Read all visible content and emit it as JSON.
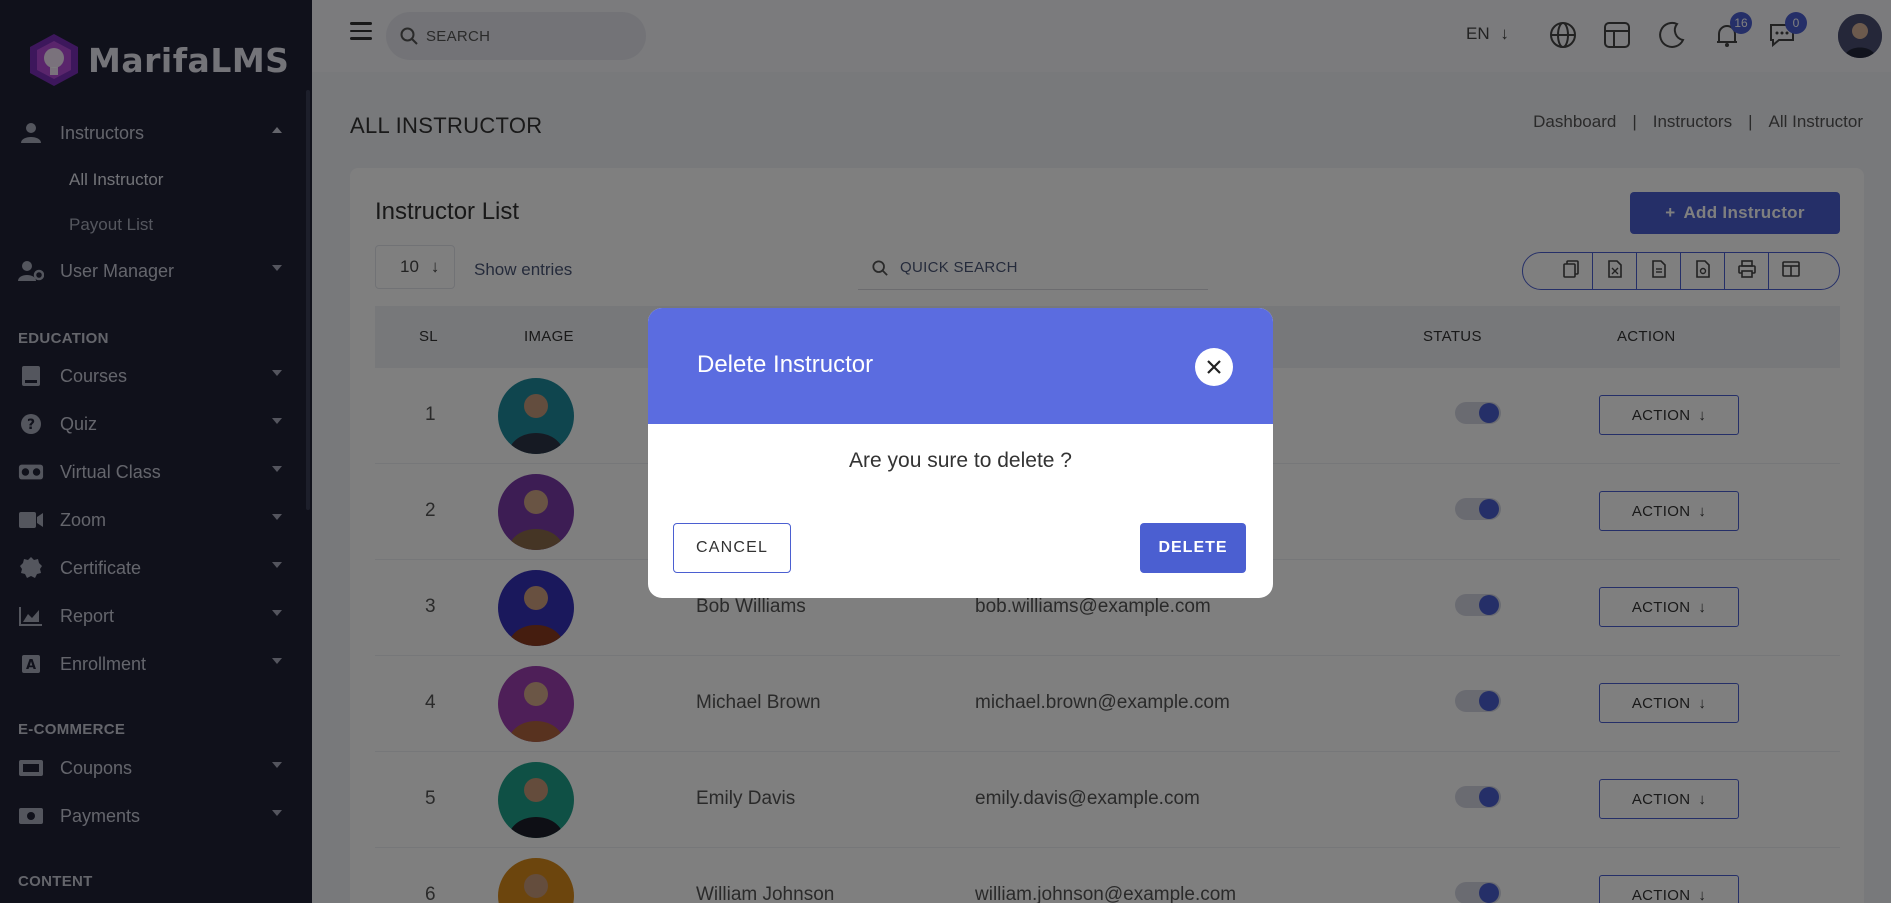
{
  "app": {
    "logo_text": "MarifaLMS"
  },
  "sidebar": {
    "items": [
      {
        "label": "Instructors",
        "icon": "user-icon"
      },
      {
        "label": "User Manager",
        "icon": "user-gear-icon"
      },
      {
        "label": "Courses",
        "icon": "book-icon"
      },
      {
        "label": "Quiz",
        "icon": "question-icon"
      },
      {
        "label": "Virtual Class",
        "icon": "vr-icon"
      },
      {
        "label": "Zoom",
        "icon": "video-icon"
      },
      {
        "label": "Certificate",
        "icon": "certificate-icon"
      },
      {
        "label": "Report",
        "icon": "chart-icon"
      },
      {
        "label": "Enrollment",
        "icon": "enrollment-icon"
      },
      {
        "label": "Coupons",
        "icon": "coupon-icon"
      },
      {
        "label": "Payments",
        "icon": "money-icon"
      }
    ],
    "submenu": [
      "All Instructor",
      "Payout List"
    ],
    "sections": [
      "EDUCATION",
      "E-COMMERCE",
      "CONTENT"
    ]
  },
  "header": {
    "search_label": "SEARCH",
    "lang": "EN",
    "notifications_count": "16",
    "messages_count": "0"
  },
  "page": {
    "title": "ALL INSTRUCTOR",
    "breadcrumb": [
      "Dashboard",
      "|",
      "Instructors",
      "|",
      "All Instructor"
    ]
  },
  "card": {
    "title": "Instructor List",
    "add_button": "Add Instructor",
    "entries_value": "10",
    "entries_label": "Show entries",
    "quick_search": "QUICK SEARCH"
  },
  "table": {
    "headers": [
      "SL",
      "IMAGE",
      "STATUS",
      "ACTION"
    ],
    "rows": [
      {
        "sl": "1",
        "name": "",
        "email": "",
        "action": "ACTION"
      },
      {
        "sl": "2",
        "name": "",
        "email": "",
        "action": "ACTION"
      },
      {
        "sl": "3",
        "name": "Bob Williams",
        "email": "bob.williams@example.com",
        "action": "ACTION"
      },
      {
        "sl": "4",
        "name": "Michael Brown",
        "email": "michael.brown@example.com",
        "action": "ACTION"
      },
      {
        "sl": "5",
        "name": "Emily Davis",
        "email": "emily.davis@example.com",
        "action": "ACTION"
      },
      {
        "sl": "6",
        "name": "William Johnson",
        "email": "william.johnson@example.com",
        "action": "ACTION"
      }
    ]
  },
  "modal": {
    "title": "Delete Instructor",
    "message": "Are you sure to delete ?",
    "cancel": "CANCEL",
    "delete": "DELETE"
  },
  "colors": {
    "accent": "#4b5fd1",
    "sidebar_bg": "#202337",
    "modal_header": "#5b6ce0"
  }
}
